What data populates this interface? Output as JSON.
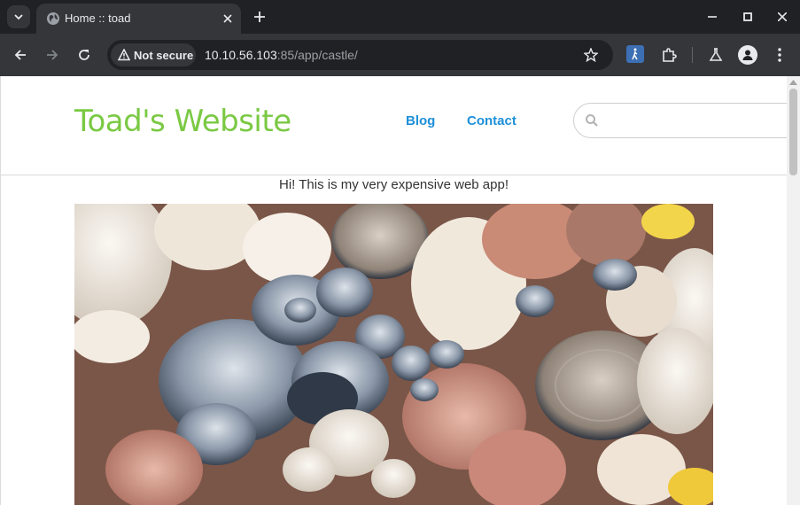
{
  "browser": {
    "tab": {
      "title": "Home :: toad",
      "icon": "globe-icon"
    },
    "new_tab_symbol": "+",
    "security_label": "Not secure",
    "url": {
      "host": "10.10.56.103",
      "rest": ":85/app/castle/"
    }
  },
  "site": {
    "title": "Toad's Website",
    "nav": [
      {
        "label": "Blog"
      },
      {
        "label": "Contact"
      }
    ],
    "search": {
      "value": "",
      "placeholder": ""
    },
    "intro": "Hi! This is my very expensive web app!",
    "hero_image": "mushrooms-photo"
  },
  "colors": {
    "site_title": "#7ac943",
    "nav_link": "#1e90d9",
    "browser_frame": "#202124",
    "toolbar": "#35363a"
  }
}
